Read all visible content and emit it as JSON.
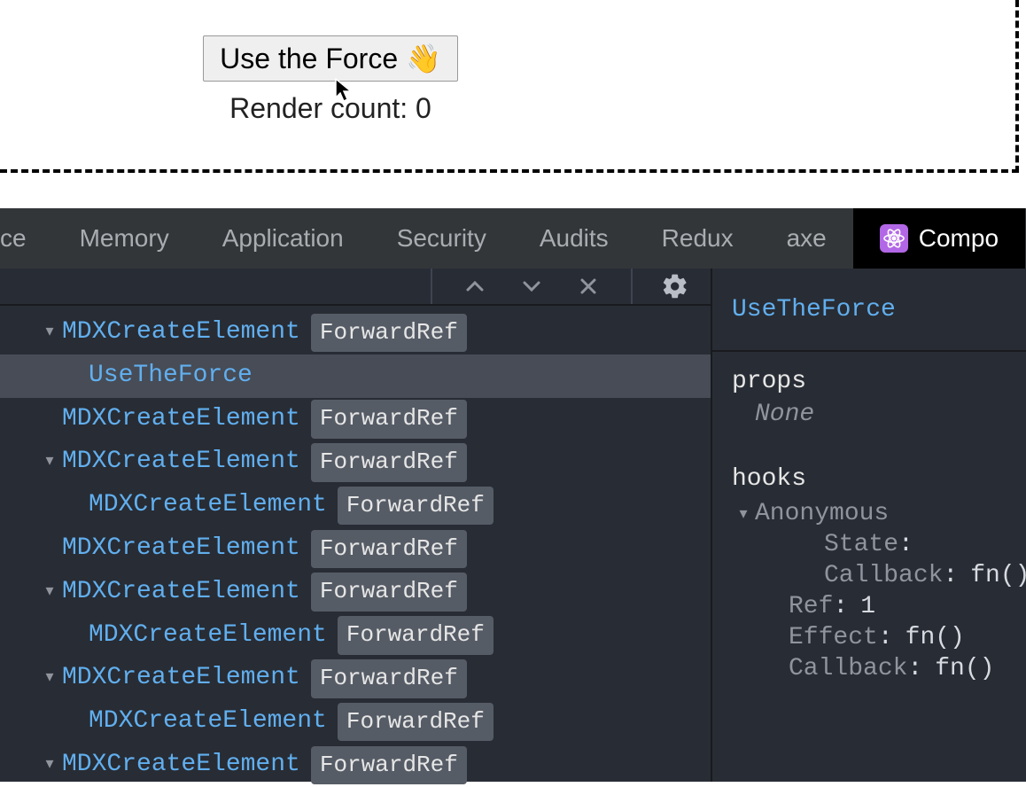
{
  "preview": {
    "button_label": "Use the Force 👋",
    "render_label": "Render count: 0"
  },
  "tabs": {
    "partial_left": "ce",
    "items": [
      "Memory",
      "Application",
      "Security",
      "Audits",
      "Redux",
      "axe"
    ],
    "active": "Compo"
  },
  "tree": {
    "rows": [
      {
        "name": "MDXCreateElement",
        "badge": "ForwardRef",
        "indent": 1,
        "disclosure": true,
        "selected": false
      },
      {
        "name": "UseTheForce",
        "badge": null,
        "indent": 2,
        "disclosure": false,
        "selected": true
      },
      {
        "name": "MDXCreateElement",
        "badge": "ForwardRef",
        "indent": 1,
        "disclosure": false,
        "selected": false
      },
      {
        "name": "MDXCreateElement",
        "badge": "ForwardRef",
        "indent": 1,
        "disclosure": true,
        "selected": false
      },
      {
        "name": "MDXCreateElement",
        "badge": "ForwardRef",
        "indent": 2,
        "disclosure": false,
        "selected": false
      },
      {
        "name": "MDXCreateElement",
        "badge": "ForwardRef",
        "indent": 1,
        "disclosure": false,
        "selected": false
      },
      {
        "name": "MDXCreateElement",
        "badge": "ForwardRef",
        "indent": 1,
        "disclosure": true,
        "selected": false
      },
      {
        "name": "MDXCreateElement",
        "badge": "ForwardRef",
        "indent": 2,
        "disclosure": false,
        "selected": false
      },
      {
        "name": "MDXCreateElement",
        "badge": "ForwardRef",
        "indent": 1,
        "disclosure": true,
        "selected": false
      },
      {
        "name": "MDXCreateElement",
        "badge": "ForwardRef",
        "indent": 2,
        "disclosure": false,
        "selected": false
      },
      {
        "name": "MDXCreateElement",
        "badge": "ForwardRef",
        "indent": 1,
        "disclosure": true,
        "selected": false
      }
    ]
  },
  "detail": {
    "selected_component": "UseTheForce",
    "props_label": "props",
    "props_none": "None",
    "hooks_label": "hooks",
    "hooks": [
      {
        "key": "Anonymous",
        "val": "",
        "indent": 0,
        "disclosure": true
      },
      {
        "key": "State",
        "val": "",
        "indent": 2,
        "disclosure": false
      },
      {
        "key": "Callback",
        "val": "fn()",
        "indent": 2,
        "disclosure": false
      },
      {
        "key": "Ref",
        "val": "1",
        "indent": 1,
        "disclosure": false
      },
      {
        "key": "Effect",
        "val": "fn()",
        "indent": 1,
        "disclosure": false
      },
      {
        "key": "Callback",
        "val": "fn()",
        "indent": 1,
        "disclosure": false
      }
    ]
  }
}
